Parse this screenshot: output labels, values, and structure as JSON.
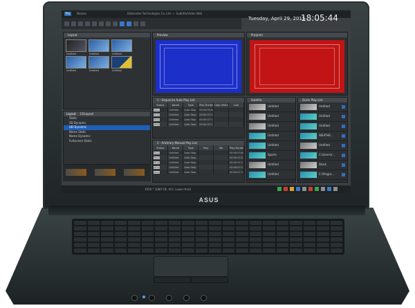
{
  "screen": {
    "app_logo": "Pro",
    "app_name": "Device",
    "window_title": "Datavideo Technologies Co. Ltd. — Subtitle/Video Wall",
    "date": "Tuesday, April 29, 2015",
    "clock": "18:05:44",
    "status_text": "1920 * 1080 50i, N.S. Lower third"
  },
  "layout_panel": {
    "title": "Layout",
    "thumbnails": [
      {
        "label": "Untitled"
      },
      {
        "label": "Untitled"
      },
      {
        "label": "Untitled"
      },
      {
        "label": "Untitled"
      },
      {
        "label": "Untitled"
      },
      {
        "label": "Untitled"
      }
    ]
  },
  "layout_list": {
    "tabs": [
      "Layout",
      "CGLayout"
    ],
    "items": [
      {
        "label": "Static",
        "selected": false
      },
      {
        "label": "SD Dynamic",
        "selected": false
      },
      {
        "label": "HD Dynamic",
        "selected": true
      },
      {
        "label": "Name Static",
        "selected": false
      },
      {
        "label": "Name Dynamic",
        "selected": false
      },
      {
        "label": "Fullscreen Static",
        "selected": false
      }
    ]
  },
  "preview": {
    "title": "Preview"
  },
  "program": {
    "title": "Program"
  },
  "sequence_playlist": {
    "title": "1 - Sequence Auto Play List",
    "columns": [
      "Status",
      "Name",
      "Type",
      "Play Duration",
      "Loop Interval",
      "Live"
    ],
    "rows": [
      {
        "status": "Show",
        "name": "Untitled",
        "type": "Auto Stop",
        "duration": "00:00:03:00",
        "loop": ""
      },
      {
        "status": "Show",
        "name": "Untitled",
        "type": "Auto Stop",
        "duration": "00:00:07:11",
        "loop": ""
      },
      {
        "status": "Show",
        "name": "Untitled",
        "type": "Auto Stop",
        "duration": "00:00:07:11",
        "loop": ""
      },
      {
        "status": "Show",
        "name": "Untitled",
        "type": "Auto Stop",
        "duration": "00:00:07:11",
        "loop": ""
      }
    ]
  },
  "arbitrary_playlist": {
    "title": "2 - Arbitrary Manual Play List",
    "columns": [
      "Status",
      "Name",
      "Type",
      "Play",
      "Mo",
      "Play Duration"
    ],
    "rows": [
      {
        "status": "Show",
        "name": "Untitled",
        "type": "Auto Stop",
        "duration": "00:00:03:00"
      },
      {
        "status": "Show",
        "name": "Untitled",
        "type": "Auto Stop",
        "duration": "00:00:07:11"
      },
      {
        "status": "Show",
        "name": "Untitled",
        "type": "Auto Stop",
        "duration": "00:00:07:11"
      },
      {
        "status": "Show",
        "name": "Untitled",
        "type": "Auto Stop",
        "duration": "00:00:07:11"
      },
      {
        "status": "Show",
        "name": "Untitled",
        "type": "Auto Stop",
        "duration": "00:00:07:11"
      }
    ]
  },
  "subtitle": {
    "title": "Subtitle",
    "items": [
      "Untitled",
      "Untitled",
      "Untitled",
      "Untitled",
      "Untitled",
      "Sports",
      "Untitled",
      "Untitled"
    ]
  },
  "quick_playlist": {
    "title": "Quick Play List",
    "items": [
      "Untitled",
      "Untitled",
      "Untitled",
      "WEATHE...",
      "Untitled",
      "C:\\Users\\r...",
      "Stock",
      "C:\\Progra..."
    ]
  },
  "laptop": {
    "brand": "ASUS"
  },
  "colors": {
    "preview_bg": "#1c2fc9",
    "program_bg": "#c21414",
    "selection": "#1e5fb8",
    "panel": "#2d3134"
  }
}
